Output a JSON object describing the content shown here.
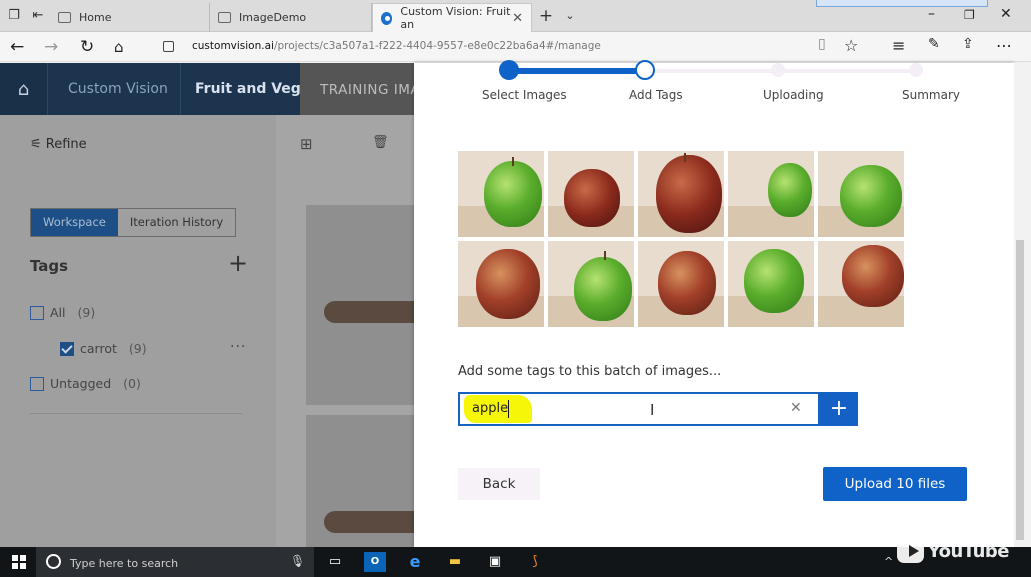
{
  "browser": {
    "tabs": [
      {
        "label": "Home"
      },
      {
        "label": "ImageDemo"
      },
      {
        "label": "Custom Vision: Fruit an"
      }
    ],
    "url_host": "customvision.ai",
    "url_path": "/projects/c3a507a1-f222-4404-9557-e8e0c22ba6a4#/manage"
  },
  "header": {
    "product": "Custom Vision",
    "project": "Fruit and Veg",
    "active_tab": "TRAINING IMA"
  },
  "sidebar": {
    "refine_label": "Refine",
    "segments": [
      "Workspace",
      "Iteration History"
    ],
    "tags_heading": "Tags",
    "tags": [
      {
        "label": "All",
        "count": "(9)",
        "checked": false
      },
      {
        "label": "carrot",
        "count": "(9)",
        "checked": true
      },
      {
        "label": "Untagged",
        "count": "(0)",
        "checked": false
      }
    ],
    "more_label": "···"
  },
  "modal": {
    "steps": [
      "Select Images",
      "Add Tags",
      "Uploading",
      "Summary"
    ],
    "current_step": 2,
    "prompt": "Add some tags to this batch of images...",
    "tag_input_value": "apple",
    "back_label": "Back",
    "upload_label": "Upload 10 files",
    "accent_color": "#0f63c8"
  },
  "taskbar": {
    "search_placeholder": "Type here to search"
  },
  "watermark": "YouTube"
}
